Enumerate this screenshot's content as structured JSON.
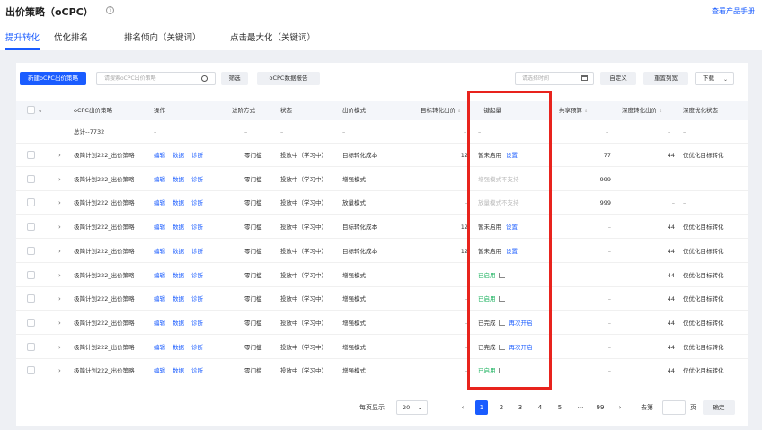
{
  "header": {
    "title": "出价策略（oCPC）",
    "help_icon": "?",
    "manual_link": "查看产品手册"
  },
  "tabs": [
    "提升转化",
    "优化排名",
    "排名倾向（关键词）",
    "点击最大化（关键词）"
  ],
  "toolbar": {
    "new_button": "新建oCPC出价策略",
    "search_placeholder": "请搜索oCPC出价策略",
    "filter_button": "筛选",
    "report_button": "oCPC数据报告",
    "date_placeholder": "请选择时间",
    "custom_button": "自定义",
    "reset_columns_button": "重置列宽",
    "download_button": "下载"
  },
  "table": {
    "columns": [
      "oCPC出价策略",
      "操作",
      "进阶方式",
      "状态",
      "出价模式",
      "目标转化出价",
      "一键起量",
      "共享预算",
      "深度转化出价",
      "深度优化状态"
    ],
    "total_row": {
      "name": "总计--7732",
      "op": "–",
      "mode": "–",
      "status": "–",
      "bid_mode": "–",
      "target": "–",
      "boost": "–",
      "budget": "–",
      "deep_bid": "–",
      "deep_status": "–"
    },
    "action_labels": [
      "编辑",
      "数据",
      "诊断"
    ],
    "rows": [
      {
        "name": "极简计划222_出价策略",
        "mode": "零门槛",
        "status": "投放中（学习中）",
        "bid_mode": "目标转化成本",
        "target": "12",
        "boost_text": "暂未启用",
        "boost_link": "设置",
        "boost_style": "normal",
        "budget": "77",
        "deep_bid": "44",
        "deep_status": "仅优化目标转化"
      },
      {
        "name": "极简计划222_出价策略",
        "mode": "零门槛",
        "status": "投放中（学习中）",
        "bid_mode": "增强模式",
        "target": "–",
        "boost_text": "增强模式不支持",
        "boost_link": "",
        "boost_style": "gray",
        "budget": "999",
        "deep_bid": "–",
        "deep_status": "–"
      },
      {
        "name": "极简计划222_出价策略",
        "mode": "零门槛",
        "status": "投放中（学习中）",
        "bid_mode": "放量模式",
        "target": "–",
        "boost_text": "放量模式不支持",
        "boost_link": "",
        "boost_style": "gray",
        "budget": "999",
        "deep_bid": "–",
        "deep_status": "–"
      },
      {
        "name": "极简计划222_出价策略",
        "mode": "零门槛",
        "status": "投放中（学习中）",
        "bid_mode": "目标转化成本",
        "target": "12",
        "boost_text": "暂未启用",
        "boost_link": "设置",
        "boost_style": "normal",
        "budget": "–",
        "deep_bid": "44",
        "deep_status": "仅优化目标转化"
      },
      {
        "name": "极简计划222_出价策略",
        "mode": "零门槛",
        "status": "投放中（学习中）",
        "bid_mode": "目标转化成本",
        "target": "12",
        "boost_text": "暂未启用",
        "boost_link": "设置",
        "boost_style": "normal",
        "budget": "–",
        "deep_bid": "44",
        "deep_status": "仅优化目标转化"
      },
      {
        "name": "极简计划222_出价策略",
        "mode": "零门槛",
        "status": "投放中（学习中）",
        "bid_mode": "增强模式",
        "target": "–",
        "boost_text": "已启用",
        "boost_link": "",
        "boost_style": "green",
        "budget": "–",
        "deep_bid": "44",
        "deep_status": "仅优化目标转化"
      },
      {
        "name": "极简计划222_出价策略",
        "mode": "零门槛",
        "status": "投放中（学习中）",
        "bid_mode": "增强模式",
        "target": "–",
        "boost_text": "已启用",
        "boost_link": "",
        "boost_style": "green",
        "budget": "–",
        "deep_bid": "44",
        "deep_status": "仅优化目标转化"
      },
      {
        "name": "极简计划222_出价策略",
        "mode": "零门槛",
        "status": "投放中（学习中）",
        "bid_mode": "增强模式",
        "target": "–",
        "boost_text": "已完成",
        "boost_link": "再次开启",
        "boost_style": "normal",
        "budget": "–",
        "deep_bid": "44",
        "deep_status": "仅优化目标转化"
      },
      {
        "name": "极简计划222_出价策略",
        "mode": "零门槛",
        "status": "投放中（学习中）",
        "bid_mode": "增强模式",
        "target": "–",
        "boost_text": "已完成",
        "boost_link": "再次开启",
        "boost_style": "normal",
        "budget": "–",
        "deep_bid": "44",
        "deep_status": "仅优化目标转化"
      },
      {
        "name": "极简计划222_出价策略",
        "mode": "零门槛",
        "status": "投放中（学习中）",
        "bid_mode": "增强模式",
        "target": "–",
        "boost_text": "已启用",
        "boost_link": "",
        "boost_style": "green",
        "budget": "–",
        "deep_bid": "44",
        "deep_status": "仅优化目标转化"
      }
    ]
  },
  "pagination": {
    "per_page_label": "每页显示",
    "per_page_value": "20",
    "pages": [
      "1",
      "2",
      "3",
      "4",
      "5",
      "···",
      "99"
    ],
    "goto_label": "去第",
    "page_unit": "页",
    "confirm": "确定"
  },
  "colors": {
    "accent": "#1a5cff",
    "highlight_box": "#e8231d",
    "enabled": "#19b15c"
  }
}
